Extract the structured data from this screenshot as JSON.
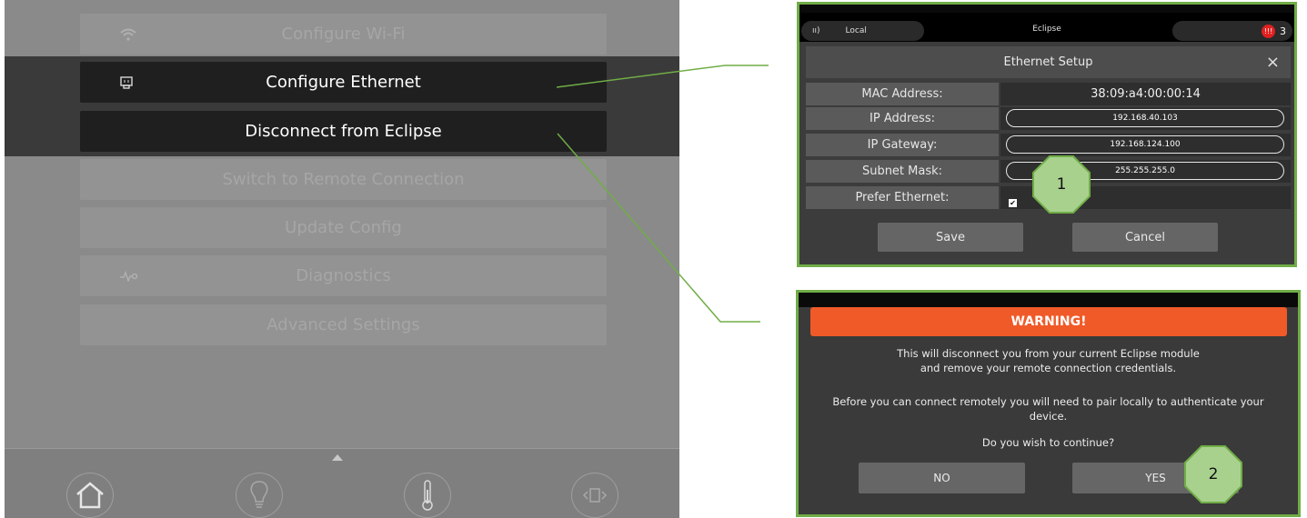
{
  "left_menu": {
    "items": [
      {
        "label": "Configure Wi-Fi",
        "icon": "wifi-icon"
      },
      {
        "label": "Configure Ethernet",
        "icon": "ethernet-icon"
      },
      {
        "label": "Disconnect from Eclipse",
        "icon": ""
      },
      {
        "label": "Switch to Remote Connection",
        "icon": ""
      },
      {
        "label": "Update Config",
        "icon": ""
      },
      {
        "label": "Diagnostics",
        "icon": "diagnostics-icon"
      },
      {
        "label": "Advanced Settings",
        "icon": ""
      }
    ],
    "bottom_nav": [
      "home-icon",
      "lightbulb-icon",
      "thermometer-icon",
      "shade-icon"
    ]
  },
  "ethernet_setup": {
    "status_bar": {
      "local_label": "Local",
      "title": "Eclipse",
      "alarm_count": "3"
    },
    "title": "Ethernet Setup",
    "close_glyph": "×",
    "fields": [
      {
        "label": "MAC Address:",
        "value": "38:09:a4:00:00:14"
      },
      {
        "label": "IP Address:",
        "value": "192.168.40.103"
      },
      {
        "label": "IP Gateway:",
        "value": "192.168.124.100"
      },
      {
        "label": "Subnet Mask:",
        "value": "255.255.255.0"
      },
      {
        "label": "Prefer Ethernet:",
        "value": "✔"
      }
    ],
    "save_label": "Save",
    "cancel_label": "Cancel"
  },
  "warning_dialog": {
    "title": "WARNING!",
    "line1": "This will disconnect you from your current Eclipse module",
    "line2": "and remove your remote connection credentials.",
    "line3": "Before you can connect remotely you will need to pair locally to authenticate your",
    "line4": "device.",
    "question": "Do you wish to continue?",
    "no_label": "NO",
    "yes_label": "YES"
  },
  "badges": {
    "one": "1",
    "two": "2"
  },
  "colors": {
    "accent_green": "#70ad47",
    "badge_fill": "#a9d18e",
    "warning_orange": "#f05a28",
    "alarm_red": "#e02020"
  }
}
